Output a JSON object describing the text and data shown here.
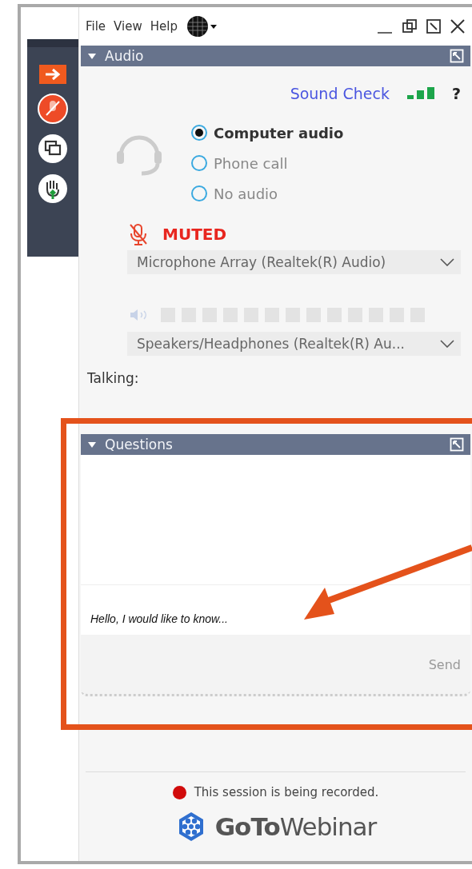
{
  "menu": [
    "File",
    "View",
    "Help"
  ],
  "audio": {
    "title": "Audio",
    "expanded": true,
    "sound_check": "Sound Check",
    "help": "?",
    "options": [
      {
        "label": "Computer audio",
        "selected": true
      },
      {
        "label": "Phone call",
        "selected": false
      },
      {
        "label": "No audio",
        "selected": false
      }
    ],
    "muted": true,
    "muted_label": "MUTED",
    "microphone": "Microphone Array (Realtek(R) Audio)",
    "speaker": "Speakers/Headphones  (Realtek(R)  Au...",
    "talking": "Talking:"
  },
  "questions": {
    "title": "Questions",
    "expanded": true,
    "input": "Hello, I would like to know...",
    "send": "Send"
  },
  "recording": "This session is being recorded.",
  "logo": "**GoTo**Webinar"
}
